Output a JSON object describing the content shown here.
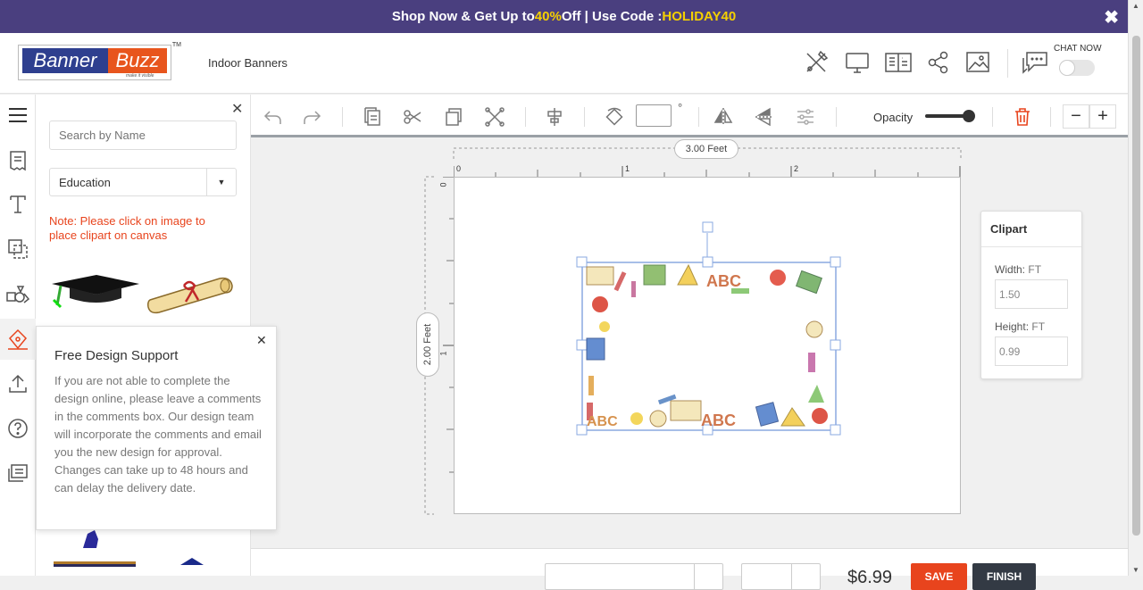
{
  "promo": {
    "prefix": "Shop Now & Get Up to ",
    "percent": "40%",
    "middle": " Off | Use Code : ",
    "code": "HOLIDAY40"
  },
  "header": {
    "logo_left": "Banner",
    "logo_right": "Buzz",
    "logo_tagline": "make it visible",
    "logo_tm": "TM",
    "title": "Indoor Banners",
    "chat_label": "CHAT NOW",
    "icons": [
      "design-tools-icon",
      "monitor-icon",
      "preview-icon",
      "share-icon",
      "image-icon",
      "chat-icon"
    ]
  },
  "left_bar": {
    "icons": [
      "menu-icon",
      "templates-icon",
      "text-icon",
      "shapes-icon",
      "clipart-icon",
      "background-icon",
      "upload-icon",
      "help-icon",
      "comments-icon"
    ]
  },
  "panel": {
    "search_placeholder": "Search by Name",
    "category": "Education",
    "note": "Note: Please click on image to place clipart on canvas"
  },
  "toolbar": {
    "rotation_value": "",
    "degree_symbol": "°",
    "opacity_label": "Opacity",
    "opacity_value": 1.0,
    "zoom_out": "−",
    "zoom_in": "+"
  },
  "canvas": {
    "width_label": "3.00 Feet",
    "height_label": "2.00 Feet",
    "ruler_top": [
      "0",
      "1",
      "2"
    ],
    "ruler_left": [
      "0",
      "1"
    ]
  },
  "clipart": {
    "title": "Clipart",
    "width_label": "Width:",
    "height_label": "Height:",
    "unit": "FT",
    "width_value": "1.50",
    "height_value": "0.99"
  },
  "popup": {
    "title": "Free Design Support",
    "body": "If you are not able to complete the design online, please leave a comments in the comments box. Our design team will incorporate the comments and email you the new design for approval. Changes can take up to 48 hours and can delay the delivery date."
  },
  "footer": {
    "price": "$6.99",
    "save": "SAVE",
    "finish": "FINISH"
  },
  "colors": {
    "promo_bg": "#4a3f7f",
    "accent": "#e8441d",
    "highlight": "#f5d000",
    "finish": "#333a44"
  }
}
